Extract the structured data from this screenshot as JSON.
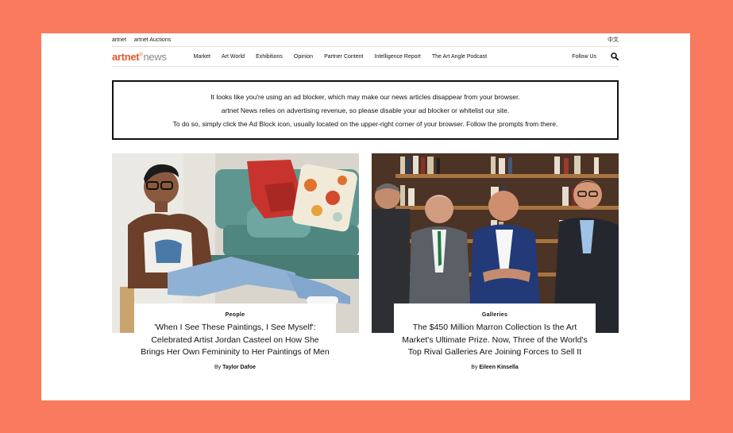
{
  "utility": {
    "links": [
      "artnet",
      "artnet Auctions"
    ],
    "language": "中文"
  },
  "logo": {
    "brand": "artnet",
    "superscript": "®",
    "suffix": "news"
  },
  "nav": {
    "items": [
      "Market",
      "Art World",
      "Exhibitions",
      "Opinion",
      "Partner Content",
      "Intelligence Report",
      "The Art Angle Podcast"
    ],
    "follow": "Follow Us",
    "search_icon": "search-icon"
  },
  "adblock": {
    "lines": [
      "It looks like you're using an ad blocker, which may make our news articles disappear from your browser.",
      "artnet News relies on advertising revenue, so please disable your ad blocker or whitelist our site.",
      "To do so, simply click the Ad Block icon, usually located on the upper-right corner of your browser. Follow the prompts from there."
    ]
  },
  "articles": [
    {
      "tag": "People",
      "headline": "'When I See These Paintings, I See Myself': Celebrated Artist Jordan Casteel on How She Brings Her Own Femininity to Her Paintings of Men",
      "by": "By",
      "author": "Taylor Dafoe"
    },
    {
      "tag": "Galleries",
      "headline": "The $450 Million Marron Collection Is the Art Market's Ultimate Prize. Now, Three of the World's Top Rival Galleries Are Joining Forces to Sell It",
      "by": "By",
      "author": "Eileen Kinsella"
    }
  ],
  "colors": {
    "background": "#F97A5F",
    "brand": "#E25A2A",
    "text": "#111111"
  }
}
